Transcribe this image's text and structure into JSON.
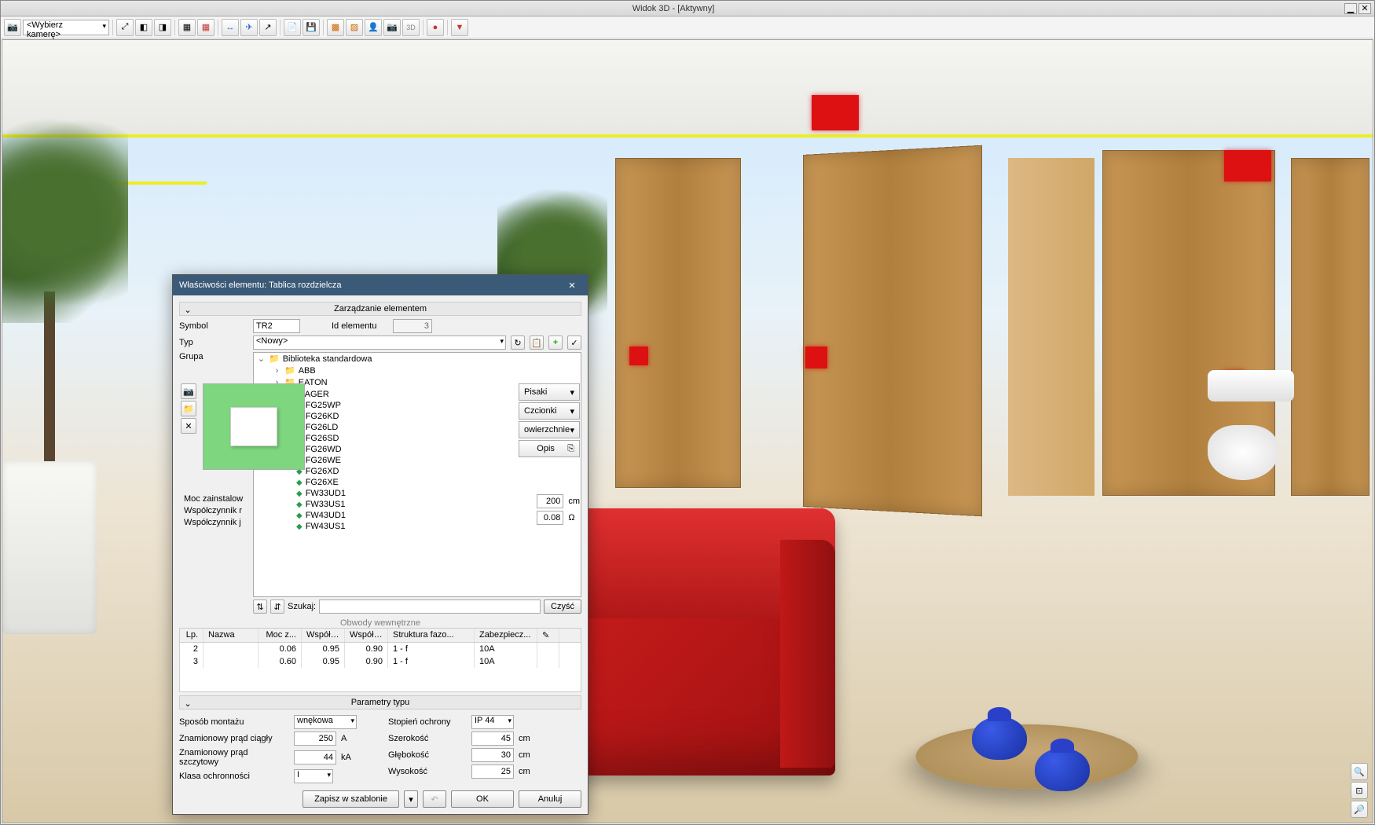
{
  "window": {
    "title": "Widok 3D - [Aktywny]"
  },
  "toolbar": {
    "camera_combo": "<Wybierz kamerę>"
  },
  "dialog": {
    "title": "Właściwości elementu: Tablica rozdzielcza",
    "sections": {
      "manage": "Zarządzanie elementem",
      "params": "Parametry typu",
      "circuits_partial": "Obwody wewnętrzne"
    },
    "labels": {
      "symbol": "Symbol",
      "id": "Id elementu",
      "type": "Typ",
      "group": "Grupa",
      "moc_label": "Moc zainstalow",
      "wsp_r": "Współczynnik r",
      "wsp_j": "Współczynnik j",
      "szukaj": "Szukaj:",
      "czysc": "Czyść",
      "height_cm": "cm",
      "ohm": "Ω"
    },
    "values": {
      "symbol": "TR2",
      "id": "3",
      "type": "<Nowy>",
      "height": "200",
      "ohm": "0.08"
    },
    "tree": {
      "root": "Biblioteka standardowa",
      "folders": [
        "ABB",
        "EATON",
        "HAGER"
      ],
      "hager_items": [
        "FG25WP",
        "FG26KD",
        "FG26LD",
        "FG26SD",
        "FG26WD",
        "FG26WE",
        "FG26XD",
        "FG26XE",
        "FW33UD1",
        "FW33US1",
        "FW43UD1",
        "FW43US1"
      ]
    },
    "right_panel": {
      "pisaki": "Pisaki",
      "czcionki": "Czcionki",
      "powierzchnie": "owierzchnie",
      "opis": "Opis"
    },
    "grid": {
      "headers": {
        "lp": "Lp.",
        "nazwa": "Nazwa",
        "moc": "Moc z...",
        "wsp1": "Współc...",
        "wsp2": "Współc...",
        "struktura": "Struktura fazo...",
        "zabezp": "Zabezpiecz..."
      },
      "rows": [
        {
          "lp": "2",
          "nazwa": "",
          "moc": "0.06",
          "wsp1": "0.95",
          "wsp2": "0.90",
          "struktura": "1 - f",
          "zabezp": "10A"
        },
        {
          "lp": "3",
          "nazwa": "",
          "moc": "0.60",
          "wsp1": "0.95",
          "wsp2": "0.90",
          "struktura": "1 - f",
          "zabezp": "10A"
        }
      ]
    },
    "params": {
      "left": {
        "sposob_label": "Sposób montażu",
        "sposob_val": "wnękowa",
        "prad_c_label": "Znamionowy prąd ciągły",
        "prad_c_val": "250",
        "prad_c_unit": "A",
        "prad_s_label": "Znamionowy prąd szczytowy",
        "prad_s_val": "44",
        "prad_s_unit": "kA",
        "klasa_label": "Klasa ochronności",
        "klasa_val": "I"
      },
      "right": {
        "stopien_label": "Stopień ochrony",
        "stopien_val": "IP 44",
        "szer_label": "Szerokość",
        "szer_val": "45",
        "unit": "cm",
        "gleb_label": "Głębokość",
        "gleb_val": "30",
        "wys_label": "Wysokość",
        "wys_val": "25"
      }
    },
    "buttons": {
      "zapisz": "Zapisz w szablonie",
      "ok": "OK",
      "anuluj": "Anuluj"
    }
  }
}
